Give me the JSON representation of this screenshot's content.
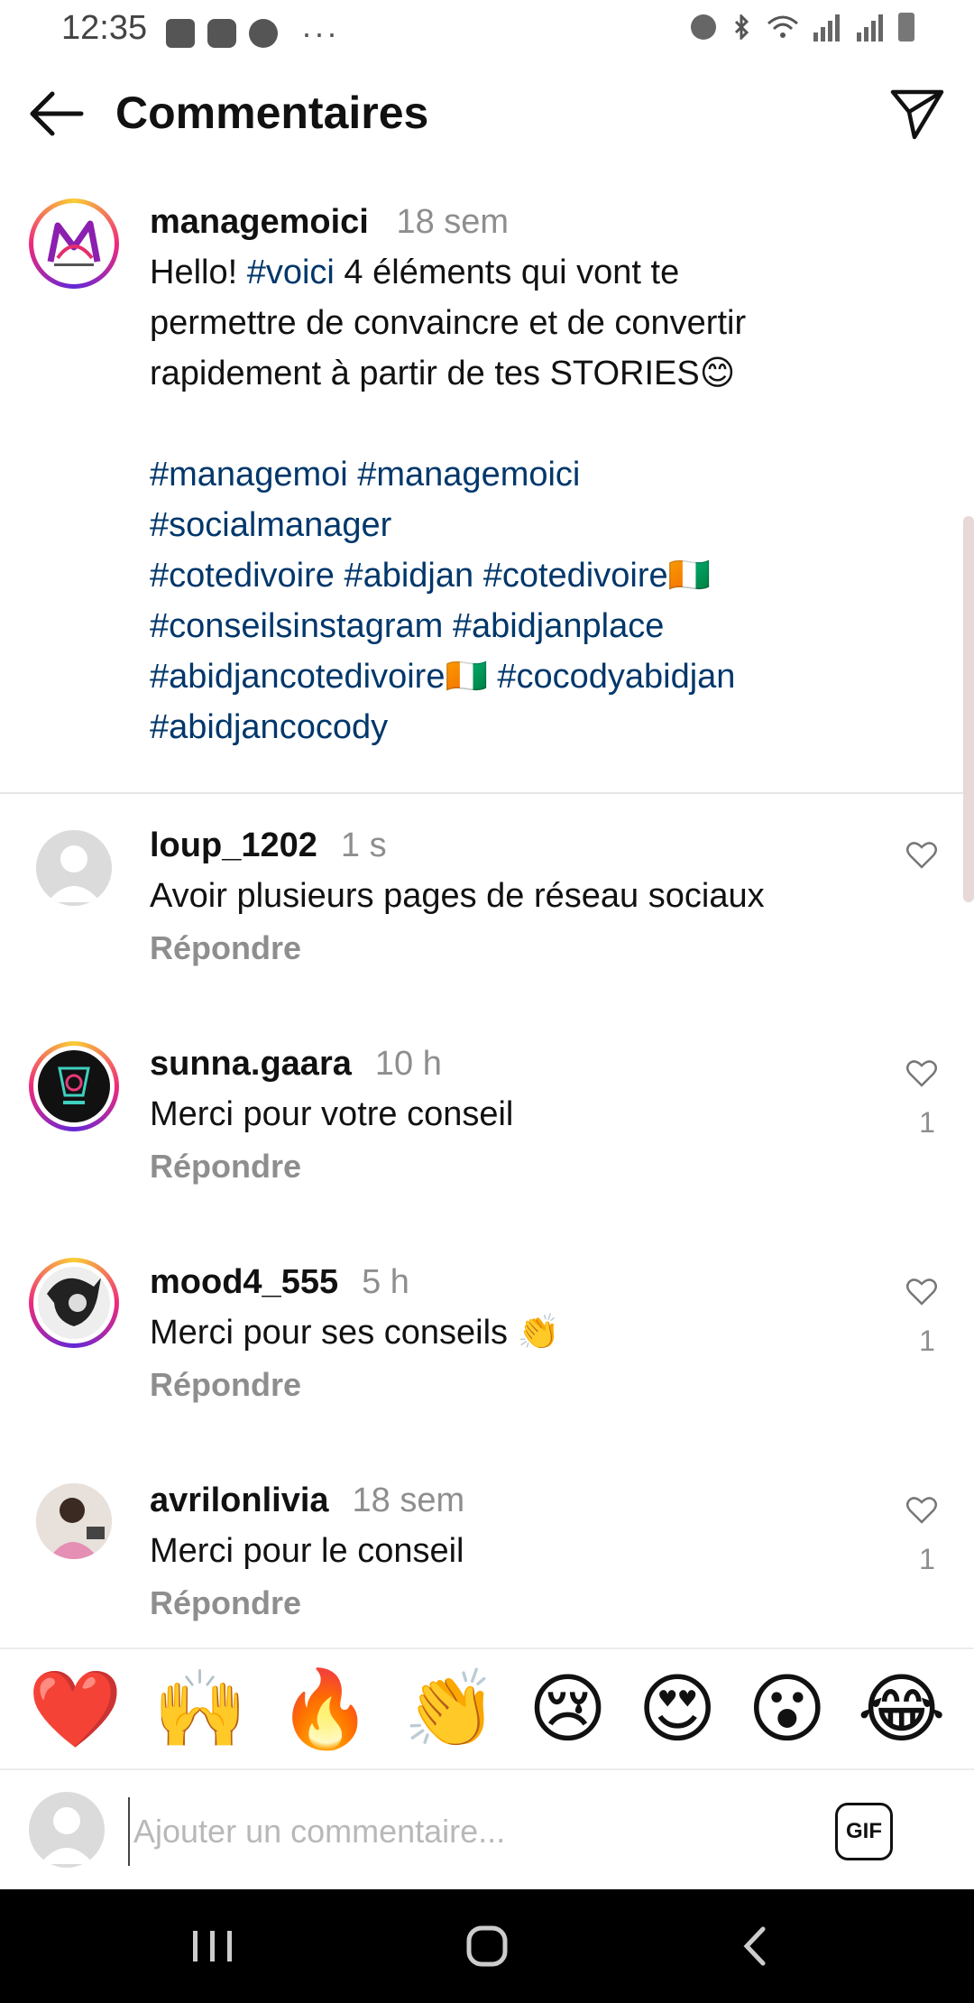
{
  "status_bar": {
    "time": "12:35",
    "more": "···"
  },
  "header": {
    "title": "Commentaires"
  },
  "caption": {
    "username": "managemoici",
    "time": "18 sem",
    "intro": "Hello! ",
    "tag_inline": "#voici",
    "text_rest": " 4 éléments qui vont te permettre de convaincre et de convertir rapidement à partir de tes STORIES😊",
    "hashtag_lines": [
      "#managemoi #managemoici",
      "#socialmanager",
      "#cotedivoire #abidjan #cotedivoire🇨🇮",
      "#conseilsinstagram #abidjanplace",
      "#abidjancotedivoire🇨🇮 #cocodyabidjan",
      "#abidjancocody"
    ]
  },
  "comments": [
    {
      "username": "loup_1202",
      "time": "1 s",
      "text": "Avoir plusieurs pages de réseau sociaux",
      "reply": "Répondre",
      "likes": ""
    },
    {
      "username": "sunna.gaara",
      "time": "10 h",
      "text": "Merci pour votre conseil",
      "reply": "Répondre",
      "likes": "1"
    },
    {
      "username": "mood4_555",
      "time": "5 h",
      "text": "Merci pour ses conseils 👏",
      "reply": "Répondre",
      "likes": "1"
    },
    {
      "username": "avrilonlivia",
      "time": "18 sem",
      "text": "Merci pour le conseil",
      "reply": "Répondre",
      "likes": "1"
    }
  ],
  "emoji_bar": [
    "❤️",
    "🙌",
    "🔥",
    "👏",
    "😢",
    "😍",
    "😮",
    "😂"
  ],
  "composer": {
    "placeholder": "Ajouter un commentaire...",
    "gif_label": "GIF"
  },
  "colors": {
    "hashtag": "#00376b",
    "muted": "#8e8e8e",
    "ring": "#ee2a7b"
  }
}
